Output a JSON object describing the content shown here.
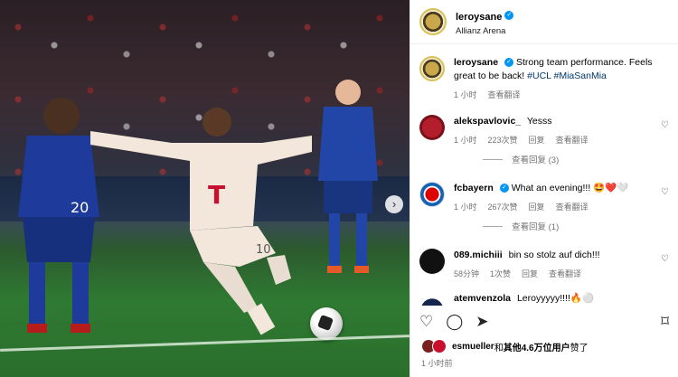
{
  "photo": {
    "next_icon": "chevron-right-icon",
    "next_glyph": "›"
  },
  "header": {
    "username": "leroysane",
    "location": "Allianz Arena"
  },
  "caption": {
    "username": "leroysane",
    "text": "Strong team performance. Feels great to be back!",
    "tags": "#UCL #MiaSanMia",
    "time": "1 小时",
    "translate": "查看翻译"
  },
  "comments": [
    {
      "username": "alekspavlovic_",
      "text": "Yesss",
      "time": "1 小时",
      "likes": "223次赞",
      "reply": "回复",
      "translate": "查看翻译",
      "replies": "查看回复 (3)"
    },
    {
      "username": "fcbayern",
      "text": "What an evening!!! 🤩❤️🤍",
      "time": "1 小时",
      "likes": "267次赞",
      "reply": "回复",
      "translate": "查看翻译",
      "replies": "查看回复 (1)"
    },
    {
      "username": "089.michiii",
      "text": "bin so stolz auf dich!!!",
      "time": "58分钟",
      "likes": "1次赞",
      "reply": "回复",
      "translate": "查看翻译"
    },
    {
      "username": "atemvenzola",
      "text": "Leroyyyyy!!!!🔥⚪",
      "time": "",
      "likes": "",
      "reply": "",
      "translate": ""
    }
  ],
  "actions": {
    "like_glyph": "♡",
    "comment_glyph": "◯",
    "share_glyph": "➤",
    "save_glyph": "⌑"
  },
  "likes": {
    "user": "esmueller",
    "connector": "和",
    "rest": "其他4.6万位用户",
    "suffix": "赞了"
  },
  "post_time": "1 小时前",
  "colors": {
    "verified": "#0095f6",
    "tag": "#00376b",
    "muted": "#737373"
  }
}
